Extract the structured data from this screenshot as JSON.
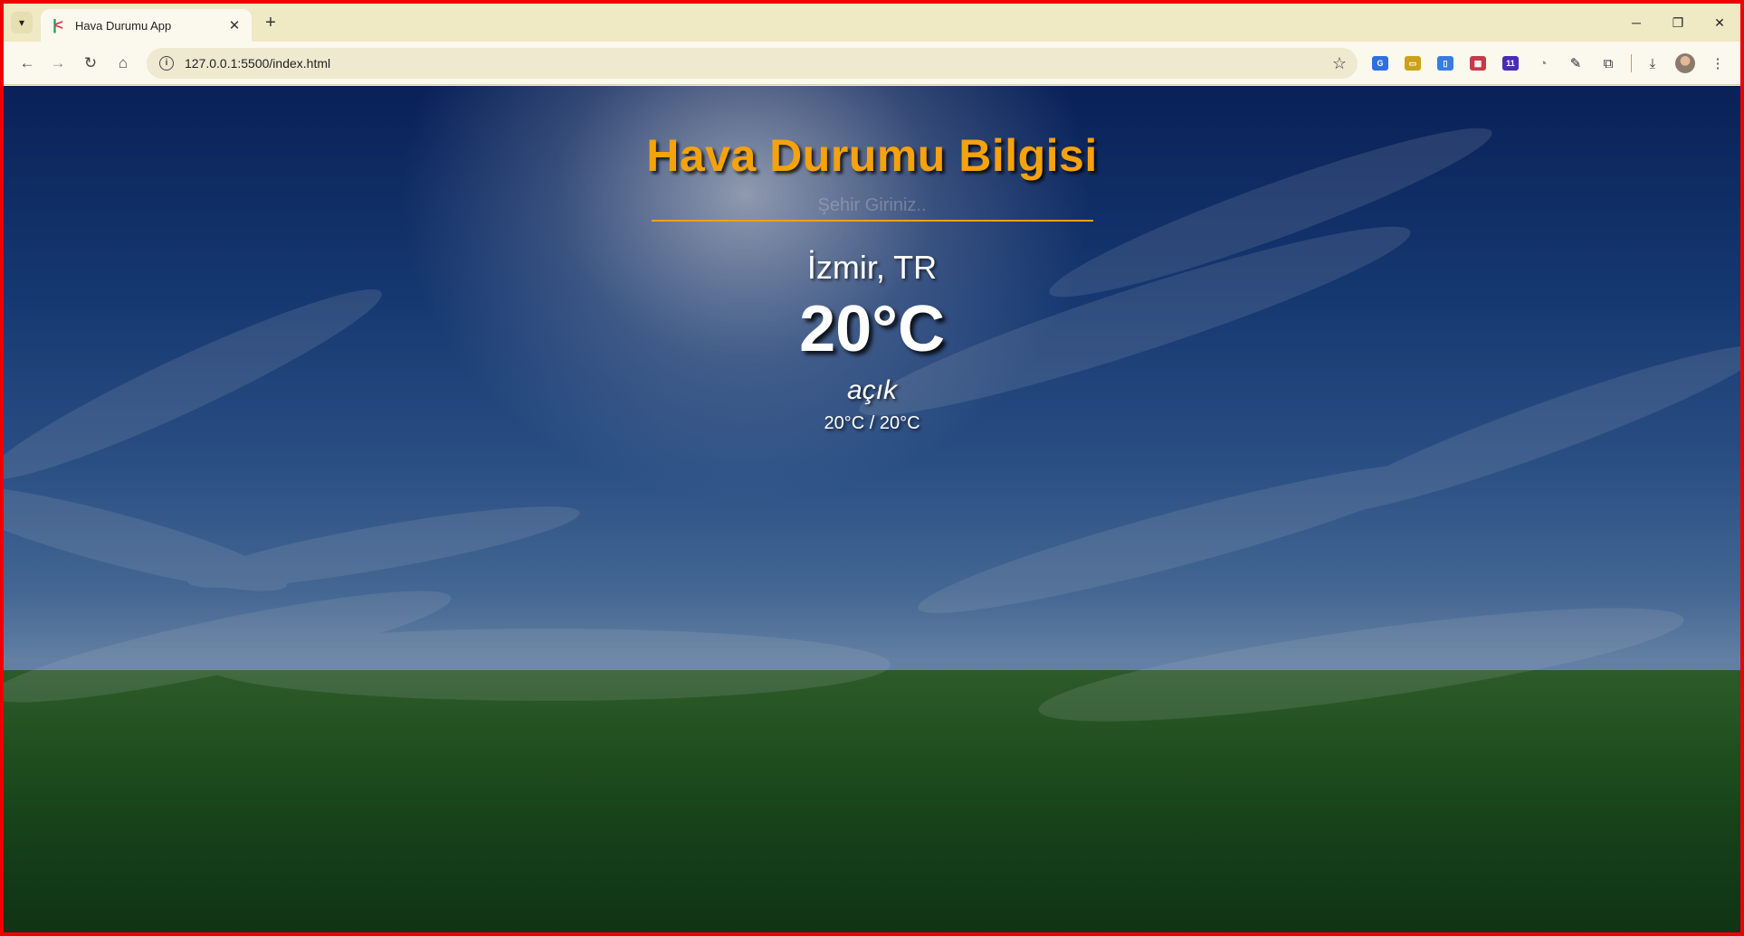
{
  "browser": {
    "tab_title": "Hava Durumu App",
    "address_bar_url": "127.0.0.1:5500/index.html",
    "new_tab_symbol": "+",
    "close_tab_symbol": "✕"
  },
  "app": {
    "title": "Hava Durumu Bilgisi",
    "search": {
      "placeholder": "Şehir Giriniz..",
      "value": ""
    },
    "weather": {
      "location": "İzmir, TR",
      "temperature": "20°C",
      "description": "açık",
      "min_max": "20°C / 20°C"
    }
  },
  "colors": {
    "title_accent": "#f5a20c",
    "input_underline": "#f0a20a",
    "window_border": "#ee0000"
  }
}
